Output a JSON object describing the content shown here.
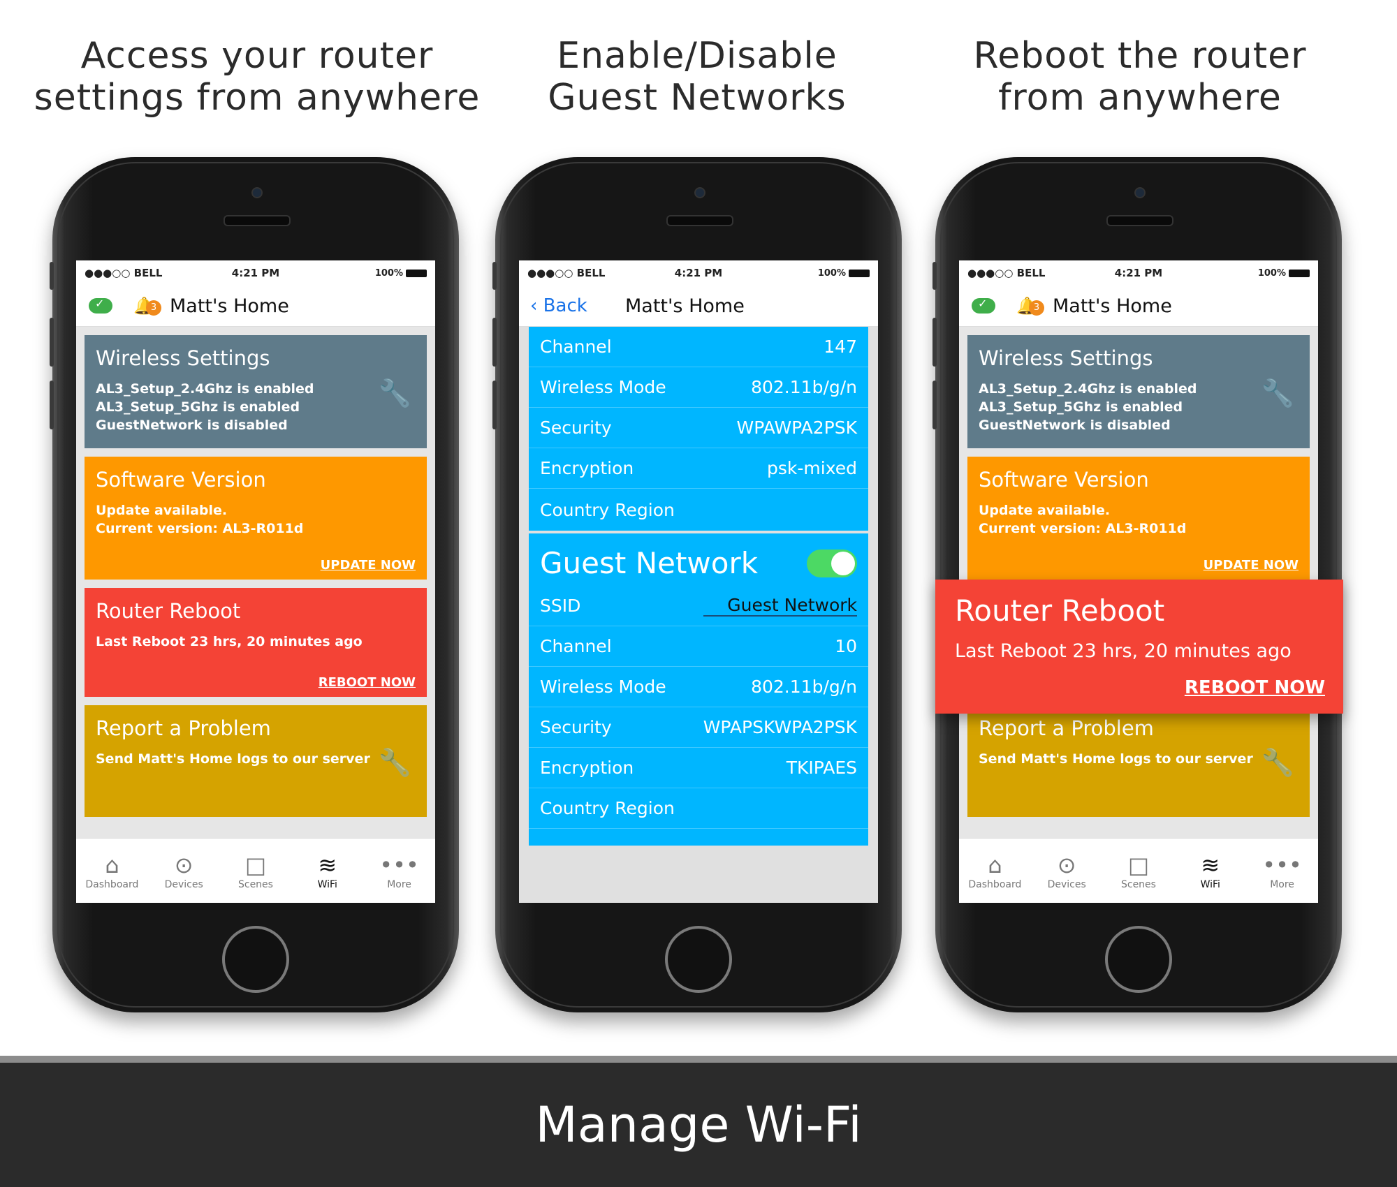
{
  "headlines": {
    "left": [
      "Access your router",
      "settings from anywhere"
    ],
    "middle": [
      "Enable/Disable",
      "Guest Networks"
    ],
    "right": [
      "Reboot the router",
      "from anywhere"
    ]
  },
  "status": {
    "carrier": "●●●○○ BELL",
    "time": "4:21 PM",
    "battery": "100%"
  },
  "home_title": "Matt's Home",
  "alert_count": "3",
  "cards": {
    "wireless": {
      "title": "Wireless Settings",
      "lines": [
        "AL3_Setup_2.4Ghz is enabled",
        "AL3_Setup_5Ghz is enabled",
        "GuestNetwork is disabled"
      ]
    },
    "software": {
      "title": "Software Version",
      "lines": [
        "Update available.",
        "Current version: AL3-R011d"
      ],
      "link": "UPDATE NOW"
    },
    "reboot": {
      "title": "Router Reboot",
      "line": "Last Reboot 23 hrs, 20 minutes ago",
      "link": "REBOOT NOW"
    },
    "report": {
      "title": "Report a Problem",
      "line": "Send Matt's Home logs to our server"
    }
  },
  "tabs": [
    {
      "label": "Dashboard",
      "icon": "home-icon"
    },
    {
      "label": "Devices",
      "icon": "devices-icon"
    },
    {
      "label": "Scenes",
      "icon": "scenes-icon"
    },
    {
      "label": "WiFi",
      "icon": "wifi-icon"
    },
    {
      "label": "More",
      "icon": "more-icon"
    }
  ],
  "wifi_detail": {
    "back_label": "Back",
    "main_rows": [
      {
        "label": "Channel",
        "value": "147"
      },
      {
        "label": "Wireless Mode",
        "value": "802.11b/g/n"
      },
      {
        "label": "Security",
        "value": "WPAWPA2PSK"
      },
      {
        "label": "Encryption",
        "value": "psk-mixed"
      },
      {
        "label": "Country Region",
        "value": ""
      }
    ],
    "guest": {
      "title": "Guest Network",
      "enabled": true,
      "ssid_label": "SSID",
      "ssid_value": "Guest Network",
      "rows": [
        {
          "label": "Channel",
          "value": "10"
        },
        {
          "label": "Wireless Mode",
          "value": "802.11b/g/n"
        },
        {
          "label": "Security",
          "value": "WPAPSKWPA2PSK"
        },
        {
          "label": "Encryption",
          "value": "TKIPAES"
        },
        {
          "label": "Country Region",
          "value": ""
        }
      ]
    }
  },
  "footer": "Manage Wi-Fi",
  "colors": {
    "wireless_card": "#5f7b8a",
    "software_card": "#fe9800",
    "reboot_card": "#f44336",
    "report_card": "#d5a300",
    "wifi_panel": "#00b6ff",
    "toggle_on": "#4cd964"
  }
}
